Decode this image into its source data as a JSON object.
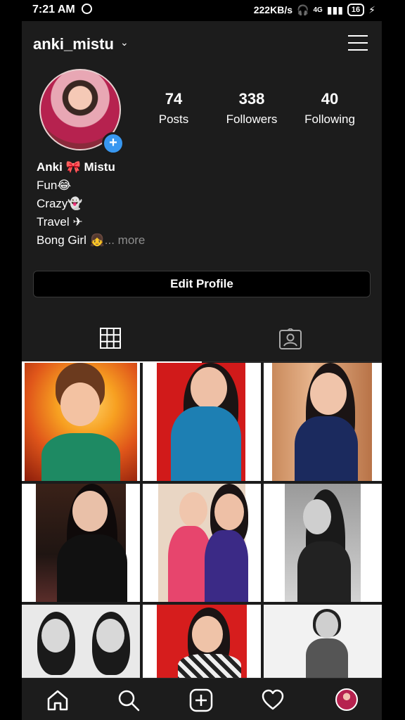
{
  "status_bar": {
    "time": "7:21 AM",
    "network_speed": "222KB/s",
    "network_type": "4G",
    "battery": "16"
  },
  "header": {
    "username": "anki_mistu"
  },
  "profile": {
    "stats": [
      {
        "value": "74",
        "label": "Posts"
      },
      {
        "value": "338",
        "label": "Followers"
      },
      {
        "value": "40",
        "label": "Following"
      }
    ],
    "bio": {
      "name": "Anki 🎀 Mistu",
      "lines": [
        "Fun😂",
        "Crazy👻",
        "Travel ✈",
        "Bong Girl 👧"
      ],
      "more": "... more"
    },
    "edit_button_label": "Edit Profile"
  },
  "tabs": [
    {
      "name": "grid",
      "icon": "grid-icon",
      "active": true
    },
    {
      "name": "tagged",
      "icon": "tagged-person-icon",
      "active": false
    }
  ],
  "colors": {
    "app_bg": "#1c1c1c",
    "accent": "#3897f0",
    "secondary_text": "#8e8e8e"
  },
  "photos": [
    {
      "name": "photo-1",
      "desc": "orange"
    },
    {
      "name": "photo-2",
      "desc": "red-blue"
    },
    {
      "name": "photo-3",
      "desc": "wood-navy"
    },
    {
      "name": "photo-4",
      "desc": "dark-room"
    },
    {
      "name": "photo-5",
      "desc": "two-girls"
    },
    {
      "name": "photo-6",
      "desc": "bw"
    },
    {
      "name": "photo-7",
      "desc": "bw-double"
    },
    {
      "name": "photo-8",
      "desc": "red-stripes"
    },
    {
      "name": "photo-9",
      "desc": "bw-white"
    }
  ],
  "bottom_nav": [
    "home-icon",
    "search-icon",
    "new-post-icon",
    "activity-heart-icon",
    "profile-avatar"
  ]
}
